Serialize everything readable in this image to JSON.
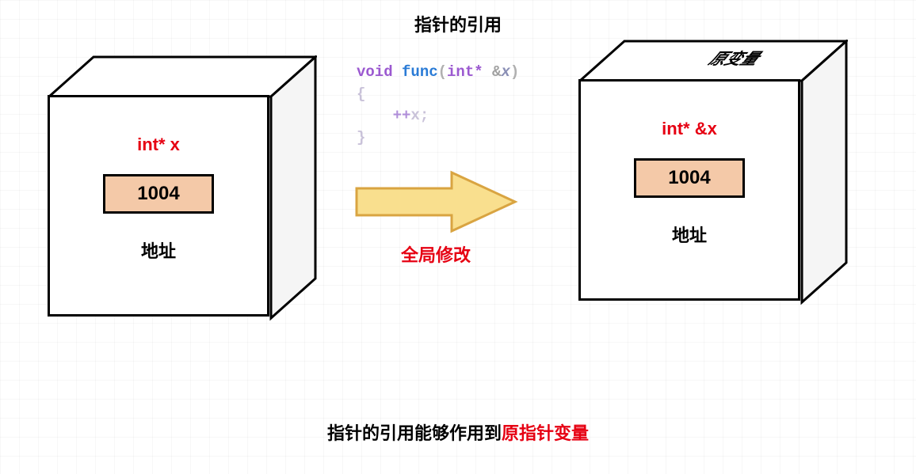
{
  "title": "指针的引用",
  "leftCube": {
    "varLabel": "int* x",
    "addrValue": "1004",
    "addrLabel": "地址"
  },
  "rightCube": {
    "topLabel": "原变量",
    "varLabel": "int* &x",
    "addrValue": "1004",
    "addrLabel": "地址"
  },
  "code": {
    "kw": "void",
    "func": "func",
    "lparen": "(",
    "type": "int*",
    "amp": "&",
    "var": "x",
    "rparen": ")",
    "lbrace": "{",
    "indent": "    ",
    "op": "++",
    "stmtVar": "x",
    "semi": ";",
    "rbrace": "}"
  },
  "arrowCaption": "全局修改",
  "footer": {
    "part1": "指针的引用能够作用到",
    "part2": "原指针变量"
  }
}
